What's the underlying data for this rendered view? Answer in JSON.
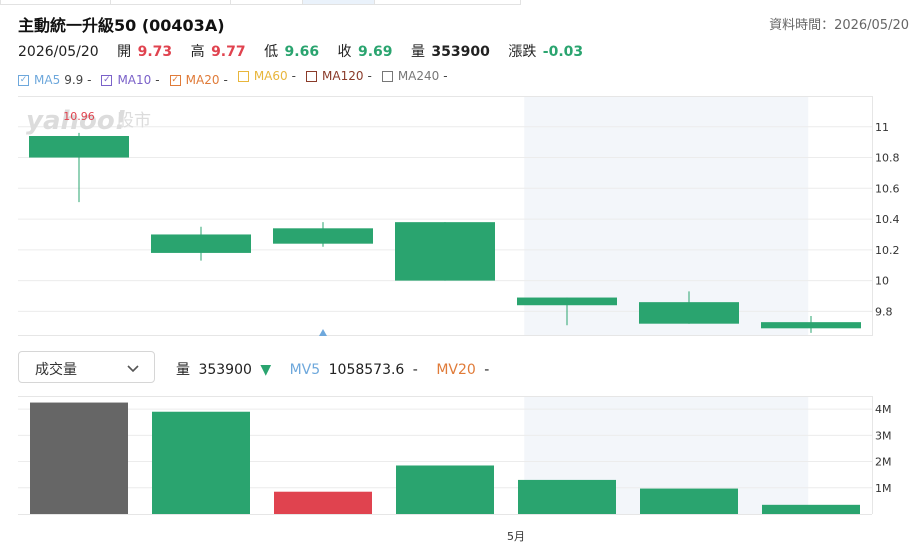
{
  "header": {
    "title": "主動統一升級50 (00403A)",
    "data_time": "資料時間：2026/05/20"
  },
  "quote": {
    "date": "2026/05/20",
    "open_label": "開",
    "open": "9.73",
    "high_label": "高",
    "high": "9.77",
    "low_label": "低",
    "low": "9.66",
    "close_label": "收",
    "close": "9.69",
    "volume_label": "量",
    "volume": "353900",
    "change_label": "漲跌",
    "change": "-0.03"
  },
  "ma_legend": [
    {
      "label": "MA5",
      "value": "9.9",
      "dash": "-",
      "color": "#6ea8dc",
      "checked": true
    },
    {
      "label": "MA10",
      "value": "",
      "dash": "-",
      "color": "#7b62c9",
      "checked": true
    },
    {
      "label": "MA20",
      "value": "",
      "dash": "-",
      "color": "#e07b39",
      "checked": true
    },
    {
      "label": "MA60",
      "value": "",
      "dash": "-",
      "color": "#e8b63c",
      "checked": false
    },
    {
      "label": "MA120",
      "value": "",
      "dash": "-",
      "color": "#8a3b2a",
      "checked": false
    },
    {
      "label": "MA240",
      "value": "",
      "dash": "-",
      "color": "#777777",
      "checked": false
    }
  ],
  "watermark": {
    "text": "yahoo!",
    "suffix": "股市"
  },
  "volume_panel": {
    "selector_label": "成交量",
    "vol_label": "量",
    "vol_value": "353900",
    "vol_arrow": "▼",
    "mv5_label": "MV5",
    "mv5_value": "1058573.6",
    "mv5_dash": "-",
    "mv20_label": "MV20",
    "mv20_value": "-"
  },
  "x_axis_label": "5月",
  "colors": {
    "up": "#e0434f",
    "down": "#2aa46f",
    "flat": "#666666",
    "highlight": "#f3f6fa"
  },
  "chart_data": [
    {
      "type": "candlestick",
      "ylim": [
        9.64,
        11.2
      ],
      "yticks": [
        "11",
        "10.8",
        "10.6",
        "10.4",
        "10.2",
        "10",
        "9.8"
      ],
      "grid": true,
      "high_label": "10.96",
      "low_label": "9.66",
      "candles": [
        {
          "open": 10.94,
          "close": 10.8,
          "high": 10.96,
          "low": 10.51
        },
        {
          "open": 10.3,
          "close": 10.18,
          "high": 10.35,
          "low": 10.13
        },
        {
          "open": 10.34,
          "close": 10.24,
          "high": 10.38,
          "low": 10.22
        },
        {
          "open": 10.38,
          "close": 10.0,
          "high": 10.38,
          "low": 10.0
        },
        {
          "open": 9.89,
          "close": 9.84,
          "high": 9.89,
          "low": 9.71
        },
        {
          "open": 9.86,
          "close": 9.72,
          "high": 9.93,
          "low": 9.72
        },
        {
          "open": 9.73,
          "close": 9.69,
          "high": 9.77,
          "low": 9.66
        }
      ]
    },
    {
      "type": "bar",
      "ylim": [
        0,
        4.5
      ],
      "yticks": [
        "4M",
        "3M",
        "2M",
        "1M"
      ],
      "grid": true,
      "values": [
        4.25,
        3.9,
        0.85,
        1.85,
        1.3,
        0.97,
        0.35
      ],
      "value_unit": "M",
      "bar_colors": [
        "flat",
        "down",
        "up",
        "down",
        "down",
        "down",
        "down"
      ]
    }
  ]
}
